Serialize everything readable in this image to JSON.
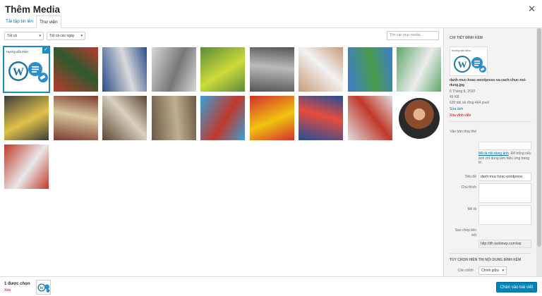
{
  "modal": {
    "title": "Thêm Media",
    "close": "✕"
  },
  "tabs": [
    {
      "label": "Tải tập tin lên"
    },
    {
      "label": "Thư viện"
    }
  ],
  "toolbar": {
    "filter_type": "Tất cả",
    "filter_date": "Tất cả các ngày",
    "search_placeholder": "Tìm các mục media..."
  },
  "thumbnails": [
    {
      "name": "wordpress-thumb",
      "selected": true,
      "colors": [
        "#ffffff",
        "#21759b"
      ],
      "caption": "Hướng dẫn thêm"
    },
    {
      "name": "football-red-players",
      "colors": [
        "#c0392b",
        "#2d5a2f"
      ]
    },
    {
      "name": "football-collage",
      "colors": [
        "#2b4c8c",
        "#d9d9d9"
      ]
    },
    {
      "name": "newspaper-comic",
      "colors": [
        "#d8d8d8",
        "#777777"
      ]
    },
    {
      "name": "tennis-ball-grass",
      "colors": [
        "#5b8c3a",
        "#cddb3a"
      ]
    },
    {
      "name": "bw-portrait",
      "colors": [
        "#555555",
        "#bbbbbb"
      ]
    },
    {
      "name": "man-white-cap",
      "colors": [
        "#c89b7b",
        "#f2f2f2"
      ]
    },
    {
      "name": "tennis-court-blue",
      "colors": [
        "#3a7bd5",
        "#4a9c4a"
      ]
    },
    {
      "name": "tennis-court-aerial",
      "colors": [
        "#5fa86b",
        "#ececec"
      ]
    },
    {
      "name": "crowd-yellow",
      "colors": [
        "#3c3c3c",
        "#e0c24a"
      ]
    },
    {
      "name": "crowd-red-flags",
      "colors": [
        "#7a3b2e",
        "#d9c8a0"
      ]
    },
    {
      "name": "construction-steel",
      "colors": [
        "#5a4630",
        "#d9d0c0"
      ]
    },
    {
      "name": "street-crowd",
      "colors": [
        "#6b5b45",
        "#bfae8f"
      ]
    },
    {
      "name": "swimmer-pool",
      "colors": [
        "#3aa0d8",
        "#c0392b"
      ]
    },
    {
      "name": "fans-red-flag",
      "colors": [
        "#d32f2f",
        "#f1c40f"
      ]
    },
    {
      "name": "team-celebration",
      "colors": [
        "#1f4e9c",
        "#e74c3c"
      ]
    },
    {
      "name": "coach-portrait",
      "colors": [
        "#e0e0e0",
        "#c0392b"
      ]
    },
    {
      "name": "man-round-portrait",
      "colors": [
        "#ffffff",
        "#8b4c2b"
      ]
    },
    {
      "name": "red-car",
      "colors": [
        "#c0392b",
        "#e8e8e8"
      ]
    }
  ],
  "details": {
    "heading": "Chi tiết đính kèm",
    "filename": "danh-muc-hoac-wordpress-va-cach-chuc-noi-dung.jpg",
    "date": "6 Tháng 8, 2020",
    "filesize": "49 KB",
    "dimensions": "620 dài và rộng 464 pixel",
    "edit": "Sửa ảnh",
    "delete": "Xóa vĩnh viễn"
  },
  "fields": {
    "alt_label": "Văn bản thay thế",
    "alt_value": "",
    "alt_help_link": "Mô tả nội dung ảnh",
    "alt_help_text": ". Để trống nếu ảnh chỉ dùng làm hiệu ứng trang trí.",
    "title_label": "Tiêu đề",
    "title_value": "danh-muc-hoac-wordpress",
    "caption_label": "Chú thích",
    "caption_value": "",
    "desc_label": "Mô tả",
    "desc_value": "",
    "url_label": "Sao chép liên kết",
    "url_value": "http://dh.webinwp.com/wp"
  },
  "display": {
    "heading": "Tùy chọn hiển thị nội dung đính kèm",
    "align_label": "Căn chỉnh",
    "align_value": "Chính giữa"
  },
  "footer": {
    "count": "1 được chọn",
    "clear": "Xóa",
    "insert": "Chèn vào bài viết"
  }
}
